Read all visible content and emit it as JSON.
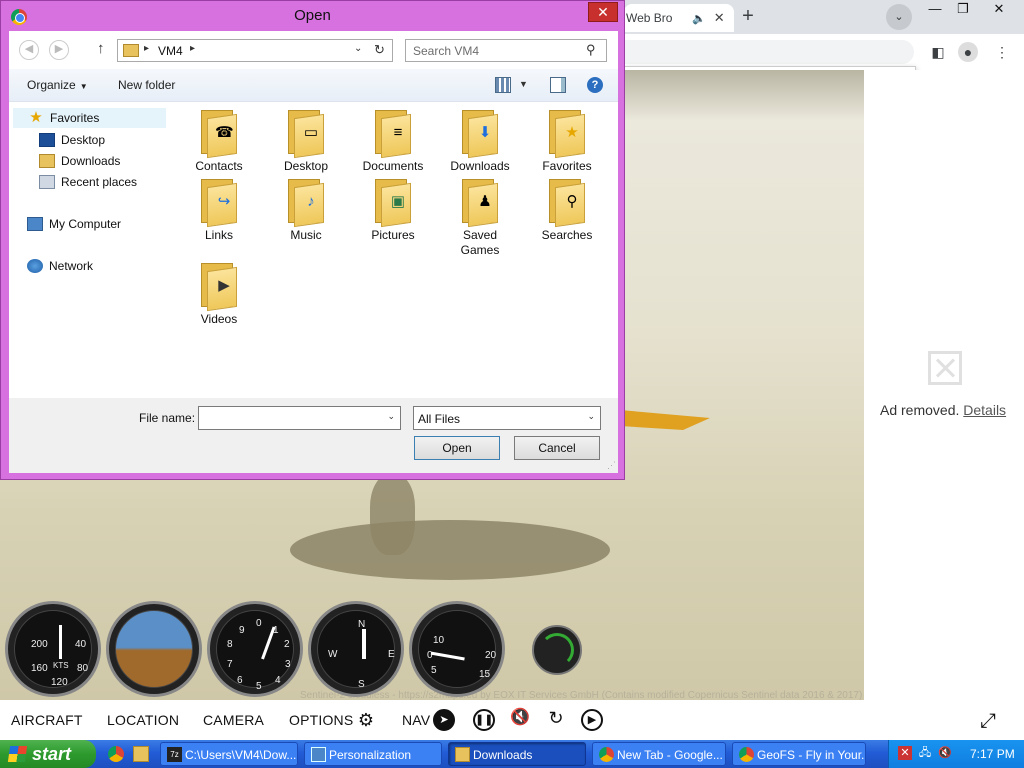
{
  "browser": {
    "tab_title": "Web Bro",
    "tab_sound_icon": "speaker-icon",
    "find_bar": {
      "prev_icon": "chevron-up-icon",
      "next_icon": "chevron-down-icon",
      "close_icon": "close-icon"
    }
  },
  "page": {
    "attribution": "Sentinel-2 cloudless - https://s2maps.eu by EOX IT Services GmbH (Contains modified Copernicus Sentinel data 2016 & 2017)",
    "ad": {
      "text": "Ad removed.",
      "link": "Details"
    },
    "instruments": [
      {
        "name": "Airspeed",
        "marks": [
          "200",
          "40",
          "160",
          "KTS",
          "80",
          "120"
        ]
      },
      {
        "name": "Attitude"
      },
      {
        "name": "Altimeter",
        "marks": [
          "9",
          "0",
          "1",
          "2",
          "3",
          "4",
          "5",
          "6",
          "7",
          "8"
        ]
      },
      {
        "name": "Heading",
        "marks": [
          "N",
          "E",
          "S",
          "W"
        ]
      },
      {
        "name": "Vertical speed",
        "marks": [
          "10",
          "5",
          "0",
          "20",
          "15"
        ]
      }
    ],
    "bottom_menu": [
      {
        "label": "AIRCRAFT"
      },
      {
        "label": "LOCATION"
      },
      {
        "label": "CAMERA"
      },
      {
        "label": "OPTIONS"
      },
      {
        "label": "NAV"
      }
    ]
  },
  "dialog": {
    "title": "Open",
    "close_label": "✕",
    "address": {
      "path": "VM4",
      "separator": "▸"
    },
    "search": {
      "placeholder": "Search VM4"
    },
    "toolbar": {
      "organize": "Organize",
      "new_folder": "New folder",
      "help": "?"
    },
    "nav": [
      {
        "label": "Favorites",
        "icon": "star-icon"
      },
      {
        "label": "Desktop",
        "icon": "desktop-icon"
      },
      {
        "label": "Downloads",
        "icon": "downloads-folder-icon"
      },
      {
        "label": "Recent places",
        "icon": "recent-places-icon"
      },
      {
        "label": "My Computer",
        "icon": "computer-icon"
      },
      {
        "label": "Network",
        "icon": "network-icon"
      }
    ],
    "files": [
      {
        "label": "Contacts",
        "badge": "☎"
      },
      {
        "label": "Desktop",
        "badge": "▭"
      },
      {
        "label": "Documents",
        "badge": "≡"
      },
      {
        "label": "Downloads",
        "badge": "⬇"
      },
      {
        "label": "Favorites",
        "badge": "★"
      },
      {
        "label": "Links",
        "badge": "↪"
      },
      {
        "label": "Music",
        "badge": "♪"
      },
      {
        "label": "Pictures",
        "badge": "▣"
      },
      {
        "label": "Saved\nGames",
        "badge": "♟"
      },
      {
        "label": "Searches",
        "badge": "⚲"
      },
      {
        "label": "Videos",
        "badge": "▶"
      }
    ],
    "file_name": {
      "label": "File name:",
      "value": ""
    },
    "filter": {
      "value": "All Files"
    },
    "buttons": {
      "open": "Open",
      "cancel": "Cancel"
    }
  },
  "taskbar": {
    "start": "start",
    "items": [
      {
        "label": "C:\\Users\\VM4\\Dow..."
      },
      {
        "label": "Personalization"
      },
      {
        "label": "Downloads"
      },
      {
        "label": "New Tab - Google..."
      },
      {
        "label": "GeoFS - Fly in Your..."
      }
    ],
    "clock": "7:17 PM"
  }
}
